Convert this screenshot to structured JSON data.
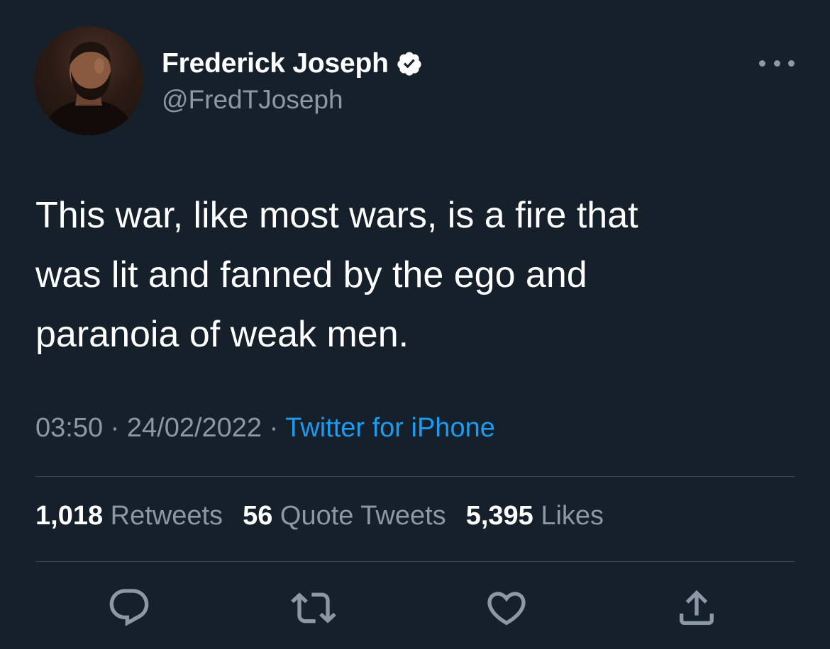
{
  "author": {
    "display_name": "Frederick Joseph",
    "handle": "@FredTJoseph",
    "avatar": "avatar-photo",
    "verified_icon": "verified-badge-icon"
  },
  "more_icon": "more-options-icon",
  "tweet": {
    "text": "This war, like most wars, is a fire that\nwas lit and fanned by the ego and\nparanoia of weak men.",
    "time": "03:50",
    "separator": " · ",
    "date": "24/02/2022",
    "source": "Twitter for iPhone"
  },
  "stats": {
    "retweets": {
      "count": "1,018",
      "label": "Retweets"
    },
    "quotes": {
      "count": "56",
      "label": "Quote Tweets"
    },
    "likes": {
      "count": "5,395",
      "label": "Likes"
    }
  },
  "actions": [
    {
      "icon": "reply-icon"
    },
    {
      "icon": "retweet-icon"
    },
    {
      "icon": "like-icon"
    },
    {
      "icon": "share-icon"
    }
  ],
  "colors": {
    "background": "#15202b",
    "primary_text": "#ffffff",
    "secondary_text": "#8b98a5",
    "link": "#1d9bf0",
    "divider": "#38444d"
  }
}
